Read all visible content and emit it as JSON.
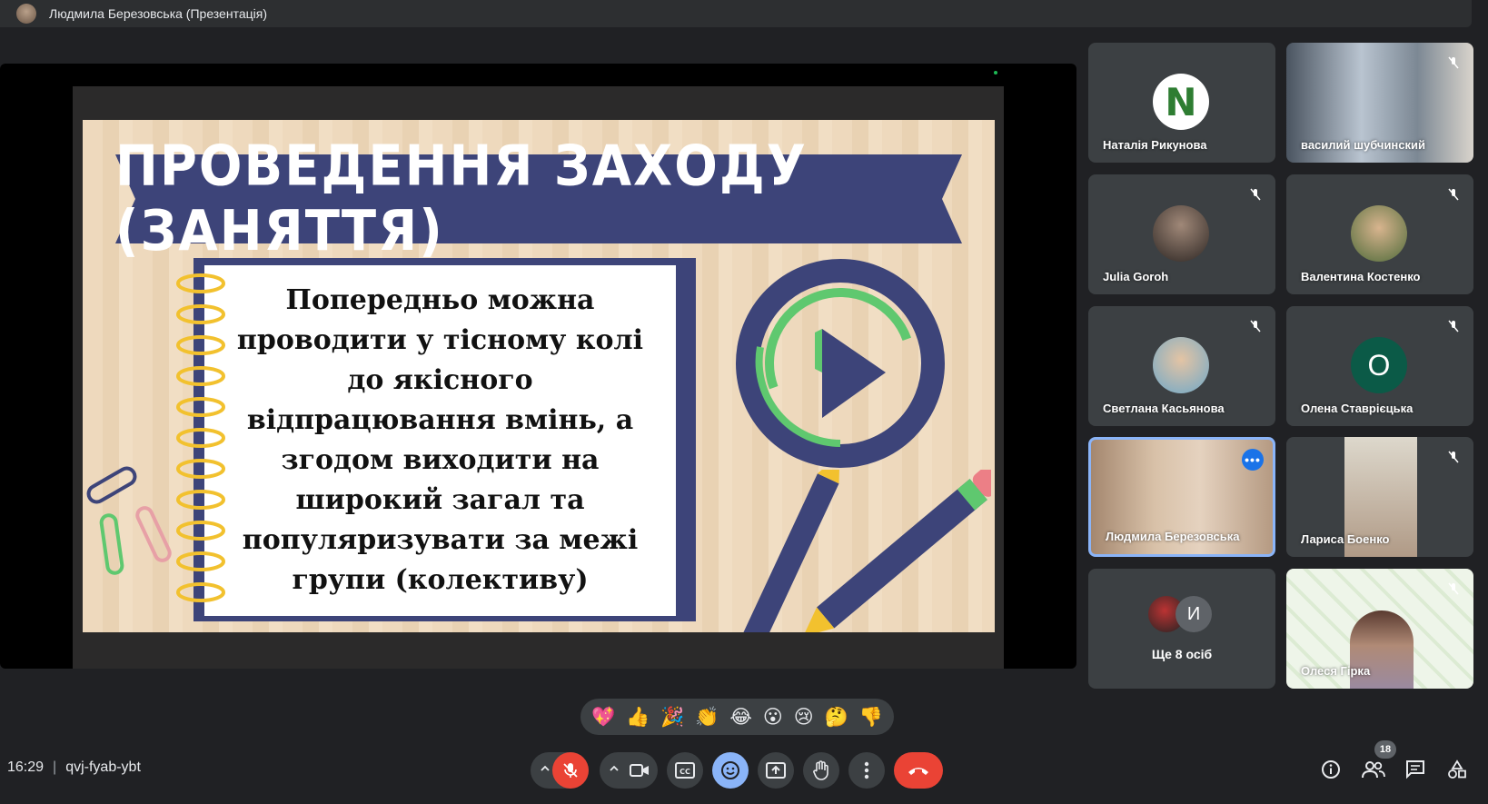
{
  "topbar": {
    "presenter_title": "Людмила Березовська (Презентація)"
  },
  "slide": {
    "banner_title": "ПРОВЕДЕННЯ ЗАХОДУ (ЗАНЯТТЯ)",
    "body_text": "Попередньо можна проводити у тісному колі до якісного відпрацювання вмінь, а згодом виходити на широкий загал та популяризувати за межі групи (колективу)"
  },
  "participants": [
    {
      "name": "Наталія Рикунова",
      "avatar_letter": "N",
      "muted": false
    },
    {
      "name": "василий шубчинский",
      "muted": true
    },
    {
      "name": "Julia Goroh",
      "muted": true
    },
    {
      "name": "Валентина Костенко",
      "muted": true
    },
    {
      "name": "Светлана Касьянова",
      "muted": true
    },
    {
      "name": "Олена Ставрієцька",
      "avatar_letter": "О",
      "muted": true
    },
    {
      "name": "Людмила Березовська",
      "muted": false,
      "active": true
    },
    {
      "name": "Лариса Боенко",
      "muted": true
    },
    {
      "name": "Олеся Гірка",
      "muted": true
    }
  ],
  "others": {
    "label": "Ще 8 осіб",
    "avatar_letter": "И"
  },
  "reactions": [
    "💖",
    "👍",
    "🎉",
    "👏",
    "😂",
    "😮",
    "😢",
    "🤔",
    "👎"
  ],
  "meeting": {
    "time": "16:29",
    "code": "qvj-fyab-ybt"
  },
  "people_count": "18",
  "colors": {
    "background": "#202124",
    "tile": "#3c4043",
    "accent": "#8ab4f8",
    "hangup": "#ea4335",
    "banner": "#3d4479",
    "ring_green": "#5fc86f"
  }
}
